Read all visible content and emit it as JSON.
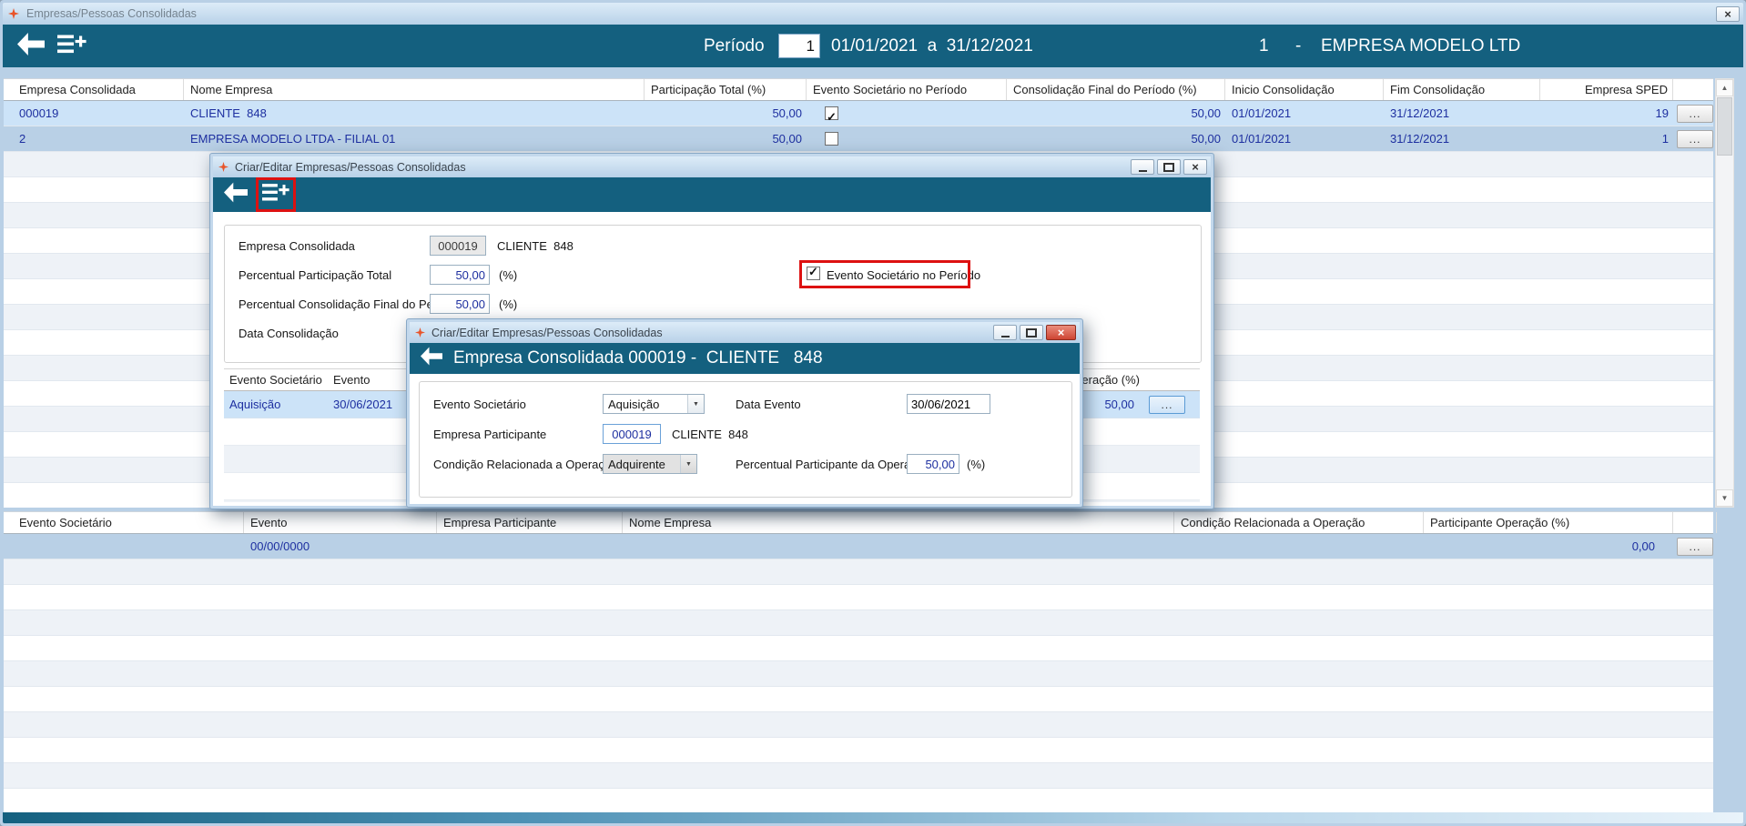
{
  "glyphs": {
    "close": "×",
    "scroll_up": "▲",
    "scroll_down": "▼",
    "dropdown": "▼"
  },
  "labels": {
    "more": "...",
    "percent": "(%)"
  },
  "main_window": {
    "title": "Empresas/Pessoas Consolidadas",
    "toolbar": {
      "periodo_label": "Período",
      "periodo_value": "1",
      "date_range": "01/01/2021  a  31/12/2021",
      "company_code": "1",
      "dash": "-",
      "company_name": "EMPRESA MODELO LTD"
    },
    "grid": {
      "columns": [
        "Empresa Consolidada",
        "Nome Empresa",
        "Participação Total (%)",
        "Evento Societário no Período",
        "Consolidação Final do Período (%)",
        "Inicio Consolidação",
        "Fim Consolidação",
        "Empresa SPED"
      ],
      "rows": [
        {
          "empresa_consolidada": "000019",
          "nome_empresa": "CLIENTE  848",
          "participacao_total": "50,00",
          "evento_societario_checked": true,
          "consolidacao_final": "50,00",
          "inicio_consolidacao": "01/01/2021",
          "fim_consolidacao": "31/12/2021",
          "empresa_sped": "19"
        },
        {
          "empresa_consolidada": "2",
          "nome_empresa": "EMPRESA MODELO LTDA - FILIAL 01",
          "participacao_total": "50,00",
          "evento_societario_checked": false,
          "consolidacao_final": "50,00",
          "inicio_consolidacao": "01/01/2021",
          "fim_consolidacao": "31/12/2021",
          "empresa_sped": "1"
        }
      ]
    },
    "bottom_grid": {
      "columns": [
        "Evento Societário",
        "Evento",
        "Empresa Participante",
        "Nome Empresa",
        "Condição Relacionada a Operação",
        "Participante Operação (%)"
      ],
      "rows": [
        {
          "evento": "00/00/0000",
          "participante_operacao": "0,00"
        }
      ]
    }
  },
  "dialog_edit": {
    "title": "Criar/Editar Empresas/Pessoas Consolidadas",
    "fields": {
      "empresa_consolidada_label": "Empresa Consolidada",
      "empresa_consolidada_value": "000019",
      "empresa_consolidada_name": "CLIENTE  848",
      "percentual_participacao_label": "Percentual Participação Total",
      "percentual_participacao_value": "50,00",
      "evento_checkbox_label": "Evento Societário no Período",
      "evento_checkbox_checked": true,
      "percentual_consolidacao_label": "Percentual Consolidação Final do Período",
      "percentual_consolidacao_value": "50,00",
      "data_consolidacao_label": "Data Consolidação"
    },
    "events_grid": {
      "col_evento_societario": "Evento Societário",
      "col_evento": "Evento",
      "col_participante_operacao": "Participante Operação (%)",
      "row": {
        "evento_societario": "Aquisição",
        "evento": "30/06/2021",
        "participante_operacao": "50,00"
      }
    }
  },
  "dialog_event": {
    "title": "Criar/Editar Empresas/Pessoas Consolidadas",
    "header_title": "Empresa Consolidada 000019 -  CLIENTE   848",
    "fields": {
      "evento_societario_label": "Evento Societário",
      "evento_societario_value": "Aquisição",
      "data_evento_label": "Data Evento",
      "data_evento_value": "30/06/2021",
      "empresa_participante_label": "Empresa Participante",
      "empresa_participante_value": "000019",
      "empresa_participante_name": "CLIENTE  848",
      "condicao_label": "Condição Relacionada a Operação",
      "condicao_value": "Adquirente",
      "percentual_operacao_label": "Percentual Participante da Operação",
      "percentual_operacao_value": "50,00"
    }
  }
}
